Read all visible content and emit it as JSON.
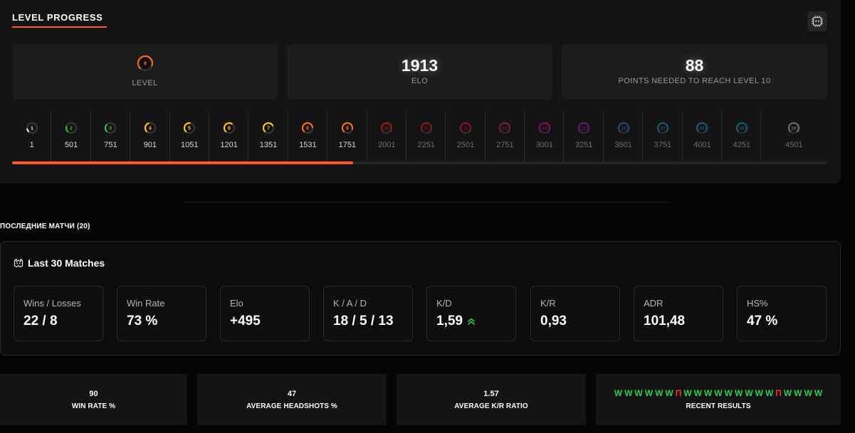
{
  "level_progress": {
    "title": "LEVEL PROGRESS",
    "current_level": {
      "value": "9",
      "label": "LEVEL",
      "color": "#ff6a1f"
    },
    "elo": {
      "value": "1913",
      "label": "ELO"
    },
    "points_needed": {
      "value": "88",
      "label": "POINTS NEEDED TO REACH LEVEL 10"
    },
    "progress_fraction": 0.418,
    "levels": [
      {
        "level": "1",
        "elo": "1",
        "color": "#e8e8e8",
        "fill": 0.12,
        "active": true
      },
      {
        "level": "2",
        "elo": "501",
        "color": "#27c43a",
        "fill": 0.22,
        "active": true
      },
      {
        "level": "3",
        "elo": "751",
        "color": "#27c43a",
        "fill": 0.32,
        "active": true
      },
      {
        "level": "4",
        "elo": "901",
        "color": "#ffc31a",
        "fill": 0.42,
        "active": true
      },
      {
        "level": "5",
        "elo": "1051",
        "color": "#ffc31a",
        "fill": 0.52,
        "active": true
      },
      {
        "level": "6",
        "elo": "1201",
        "color": "#ffc31a",
        "fill": 0.62,
        "active": true
      },
      {
        "level": "7",
        "elo": "1351",
        "color": "#ffc31a",
        "fill": 0.72,
        "active": true
      },
      {
        "level": "8",
        "elo": "1531",
        "color": "#ff6a1f",
        "fill": 0.8,
        "active": true
      },
      {
        "level": "9",
        "elo": "1751",
        "color": "#ff6a1f",
        "fill": 0.88,
        "active": true
      },
      {
        "level": "10",
        "elo": "2001",
        "color": "#b3241c",
        "fill": 1.0,
        "active": false
      },
      {
        "level": "11",
        "elo": "2251",
        "color": "#a8192b",
        "fill": 1.0,
        "active": false
      },
      {
        "level": "12",
        "elo": "2501",
        "color": "#a8192b",
        "fill": 1.0,
        "active": false
      },
      {
        "level": "13",
        "elo": "2751",
        "color": "#a01a55",
        "fill": 1.0,
        "active": false
      },
      {
        "level": "14",
        "elo": "3001",
        "color": "#9b1672",
        "fill": 1.0,
        "active": false
      },
      {
        "level": "15",
        "elo": "3251",
        "color": "#7d1f8f",
        "fill": 1.0,
        "active": false
      },
      {
        "level": "16",
        "elo": "3501",
        "color": "#285a92",
        "fill": 1.0,
        "active": false
      },
      {
        "level": "17",
        "elo": "3751",
        "color": "#1f6e8c",
        "fill": 1.0,
        "active": false
      },
      {
        "level": "18",
        "elo": "4001",
        "color": "#1f7090",
        "fill": 1.0,
        "active": false
      },
      {
        "level": "19",
        "elo": "4251",
        "color": "#1f7090",
        "fill": 1.0,
        "active": false
      },
      {
        "level": "20",
        "elo": "4501",
        "color": "#8a8a8a",
        "fill": 1.0,
        "active": false
      }
    ]
  },
  "recent_matches_title": "ПОСЛЕДНИЕ МАТЧИ (20)",
  "last_matches": {
    "title": "Last 30 Matches",
    "stats": [
      {
        "label": "Wins / Losses",
        "value": "22 / 8"
      },
      {
        "label": "Win Rate",
        "value": "73 %"
      },
      {
        "label": "Elo",
        "value": "+495"
      },
      {
        "label": "K / A / D",
        "value": "18 / 5 / 13"
      },
      {
        "label": "K/D",
        "value": "1,59",
        "trend": "up"
      },
      {
        "label": "K/R",
        "value": "0,93"
      },
      {
        "label": "ADR",
        "value": "101,48"
      },
      {
        "label": "HS%",
        "value": "47 %"
      }
    ]
  },
  "summary": [
    {
      "value": "90",
      "label": "WIN RATE %"
    },
    {
      "value": "47",
      "label": "AVERAGE HEADSHOTS %"
    },
    {
      "value": "1.57",
      "label": "AVERAGE K/R RATIO"
    }
  ],
  "recent_results": {
    "label": "RECENT RESULTS",
    "items": [
      "W",
      "W",
      "W",
      "W",
      "W",
      "W",
      "П",
      "W",
      "W",
      "W",
      "W",
      "W",
      "W",
      "W",
      "W",
      "W",
      "П",
      "W",
      "W",
      "W",
      "W"
    ],
    "win_color": "#2ecc55",
    "loss_color": "#ff2d3c"
  }
}
